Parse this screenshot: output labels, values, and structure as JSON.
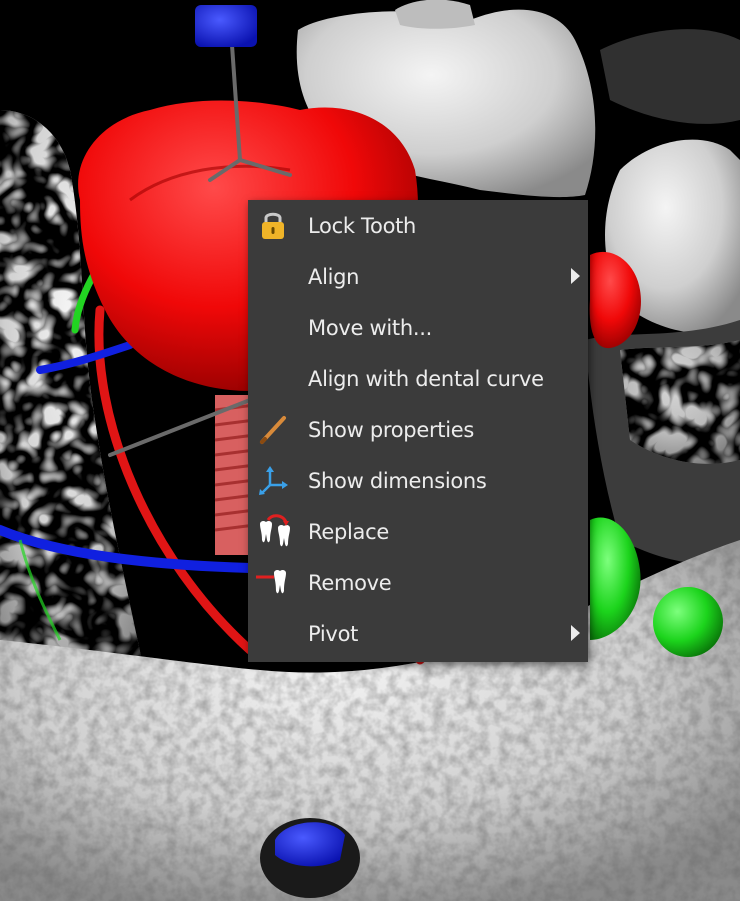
{
  "viewport": {
    "title": "",
    "colors": {
      "background": "#000000",
      "bone": "#d9d9d9",
      "crown": "#ff1010",
      "axis_red": "#e01515",
      "axis_green": "#22d422",
      "axis_blue": "#1020e0",
      "menu_bg": "#3b3b3b",
      "menu_text": "#ececec"
    }
  },
  "context_menu": {
    "items": [
      {
        "label": "Lock Tooth",
        "icon": "lock-icon",
        "has_submenu": false
      },
      {
        "label": "Align",
        "icon": "",
        "has_submenu": true
      },
      {
        "label": "Move with...",
        "icon": "",
        "has_submenu": false
      },
      {
        "label": "Align with dental curve",
        "icon": "",
        "has_submenu": false
      },
      {
        "label": "Show properties",
        "icon": "pencil-icon",
        "has_submenu": false
      },
      {
        "label": "Show dimensions",
        "icon": "axes-icon",
        "has_submenu": false
      },
      {
        "label": "Replace",
        "icon": "replace-tooth-icon",
        "has_submenu": false
      },
      {
        "label": "Remove",
        "icon": "remove-tooth-icon",
        "has_submenu": false
      },
      {
        "label": "Pivot",
        "icon": "",
        "has_submenu": true
      }
    ]
  }
}
